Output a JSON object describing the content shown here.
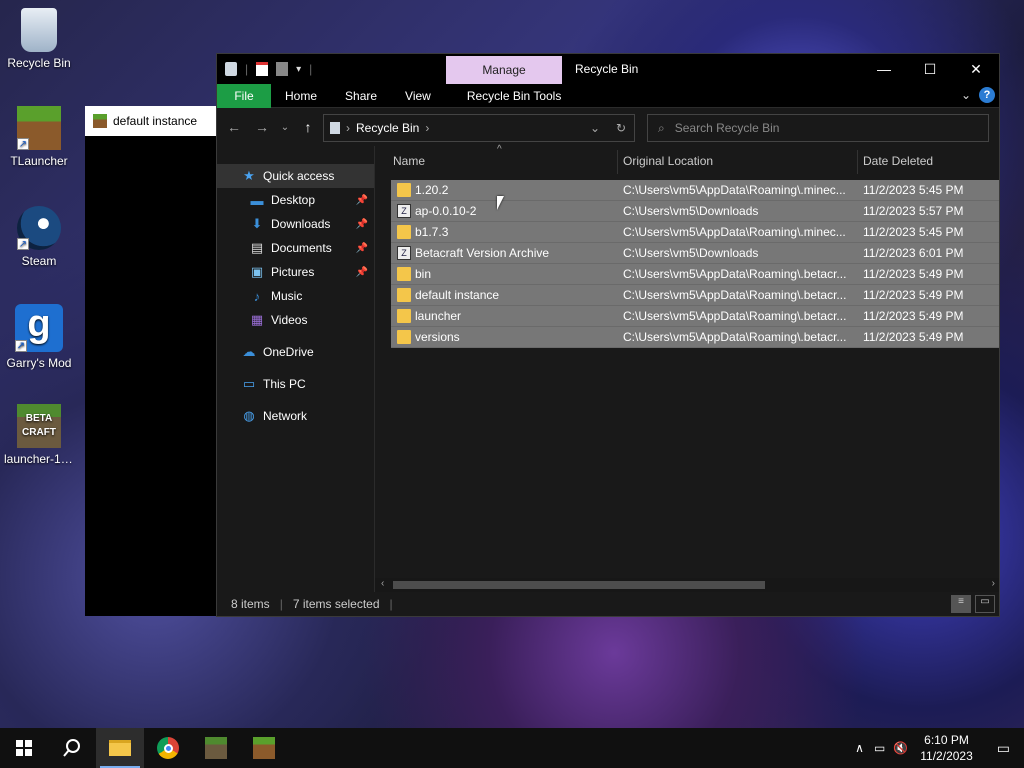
{
  "desktop": {
    "icons": [
      {
        "label": "Recycle Bin",
        "icon": "recycle-bin-icon"
      },
      {
        "label": "TLauncher",
        "icon": "minecraft-block-icon"
      },
      {
        "label": "Steam",
        "icon": "steam-icon"
      },
      {
        "label": "Garry's Mod",
        "icon": "garrys-mod-icon"
      },
      {
        "label": "launcher-1....",
        "icon": "betacraft-icon"
      }
    ]
  },
  "background_window": {
    "tab_label": "default instance"
  },
  "explorer": {
    "manage_tab": "Manage",
    "title": "Recycle Bin",
    "ribbon": {
      "file": "File",
      "home": "Home",
      "share": "Share",
      "view": "View",
      "tools": "Recycle Bin Tools"
    },
    "address": {
      "location": "Recycle Bin"
    },
    "search": {
      "placeholder": "Search Recycle Bin"
    },
    "nav": {
      "quick_access": "Quick access",
      "desktop": "Desktop",
      "downloads": "Downloads",
      "documents": "Documents",
      "pictures": "Pictures",
      "music": "Music",
      "videos": "Videos",
      "onedrive": "OneDrive",
      "this_pc": "This PC",
      "network": "Network"
    },
    "columns": {
      "name": "Name",
      "location": "Original Location",
      "date": "Date Deleted"
    },
    "files": [
      {
        "name": "1.20.2",
        "location": "C:\\Users\\vm5\\AppData\\Roaming\\.minec...",
        "date": "11/2/2023 5:45 PM",
        "type": "folder"
      },
      {
        "name": "ap-0.0.10-2",
        "location": "C:\\Users\\vm5\\Downloads",
        "date": "11/2/2023 5:57 PM",
        "type": "zip"
      },
      {
        "name": "b1.7.3",
        "location": "C:\\Users\\vm5\\AppData\\Roaming\\.minec...",
        "date": "11/2/2023 5:45 PM",
        "type": "folder"
      },
      {
        "name": "Betacraft Version Archive",
        "location": "C:\\Users\\vm5\\Downloads",
        "date": "11/2/2023 6:01 PM",
        "type": "zip"
      },
      {
        "name": "bin",
        "location": "C:\\Users\\vm5\\AppData\\Roaming\\.betacr...",
        "date": "11/2/2023 5:49 PM",
        "type": "folder"
      },
      {
        "name": "default instance",
        "location": "C:\\Users\\vm5\\AppData\\Roaming\\.betacr...",
        "date": "11/2/2023 5:49 PM",
        "type": "folder"
      },
      {
        "name": "launcher",
        "location": "C:\\Users\\vm5\\AppData\\Roaming\\.betacr...",
        "date": "11/2/2023 5:49 PM",
        "type": "folder"
      },
      {
        "name": "versions",
        "location": "C:\\Users\\vm5\\AppData\\Roaming\\.betacr...",
        "date": "11/2/2023 5:49 PM",
        "type": "folder"
      }
    ],
    "status": {
      "count": "8 items",
      "selected": "7 items selected"
    }
  },
  "taskbar": {
    "time": "6:10 PM",
    "date": "11/2/2023"
  }
}
